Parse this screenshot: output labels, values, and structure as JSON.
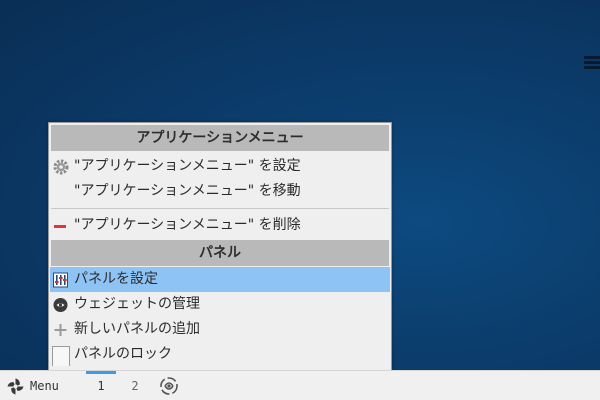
{
  "context_menu": {
    "section_app": "アプリケーションメニュー",
    "items_app": [
      {
        "label": "\"アプリケーションメニュー\" を設定",
        "icon": "gear-icon"
      },
      {
        "label": "\"アプリケーションメニュー\" を移動",
        "icon": ""
      },
      {
        "label": "\"アプリケーションメニュー\" を削除",
        "icon": "remove-icon"
      }
    ],
    "section_panel": "パネル",
    "items_panel": [
      {
        "label": "パネルを設定",
        "icon": "panel-settings-icon",
        "selected": true
      },
      {
        "label": "ウェジェットの管理",
        "icon": "widget-icon"
      },
      {
        "label": "新しいパネルの追加",
        "icon": "plus-icon"
      },
      {
        "label": "パネルのロック",
        "icon": "lock-checkbox-icon"
      }
    ]
  },
  "taskbar": {
    "menu_label": "Menu",
    "workspaces": [
      "1",
      "2"
    ],
    "active_workspace": "1"
  },
  "colors": {
    "selection": "#8ec3f5",
    "header_bg": "#b9b9b9",
    "menu_bg": "#efefef",
    "accent": "#3d9be6",
    "remove_red": "#e0333c"
  }
}
